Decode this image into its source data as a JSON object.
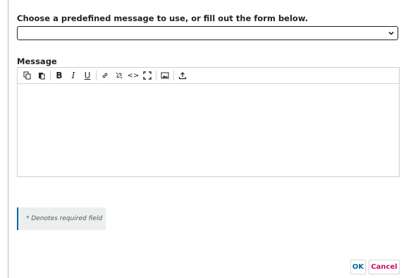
{
  "form": {
    "choose_label": "Choose a predefined message to use, or fill out the form below.",
    "selected_value": "",
    "message_label": "Message",
    "message_value": "",
    "required_notice": "* Denotes required field"
  },
  "toolbar": {
    "buttons": [
      {
        "name": "copy-icon"
      },
      {
        "name": "paste-icon"
      },
      {
        "name": "bold-icon",
        "glyph": "B"
      },
      {
        "name": "italic-icon",
        "glyph": "I"
      },
      {
        "name": "underline-icon",
        "glyph": "U"
      },
      {
        "name": "link-icon"
      },
      {
        "name": "unlink-icon"
      },
      {
        "name": "code-icon",
        "glyph": "<>"
      },
      {
        "name": "fullscreen-icon"
      },
      {
        "name": "image-icon"
      },
      {
        "name": "upload-icon"
      }
    ]
  },
  "actions": {
    "ok_label": "OK",
    "cancel_label": "Cancel"
  },
  "colors": {
    "accent": "#006798",
    "cancel": "#d00a6c",
    "notice_bg": "#ecefef"
  }
}
